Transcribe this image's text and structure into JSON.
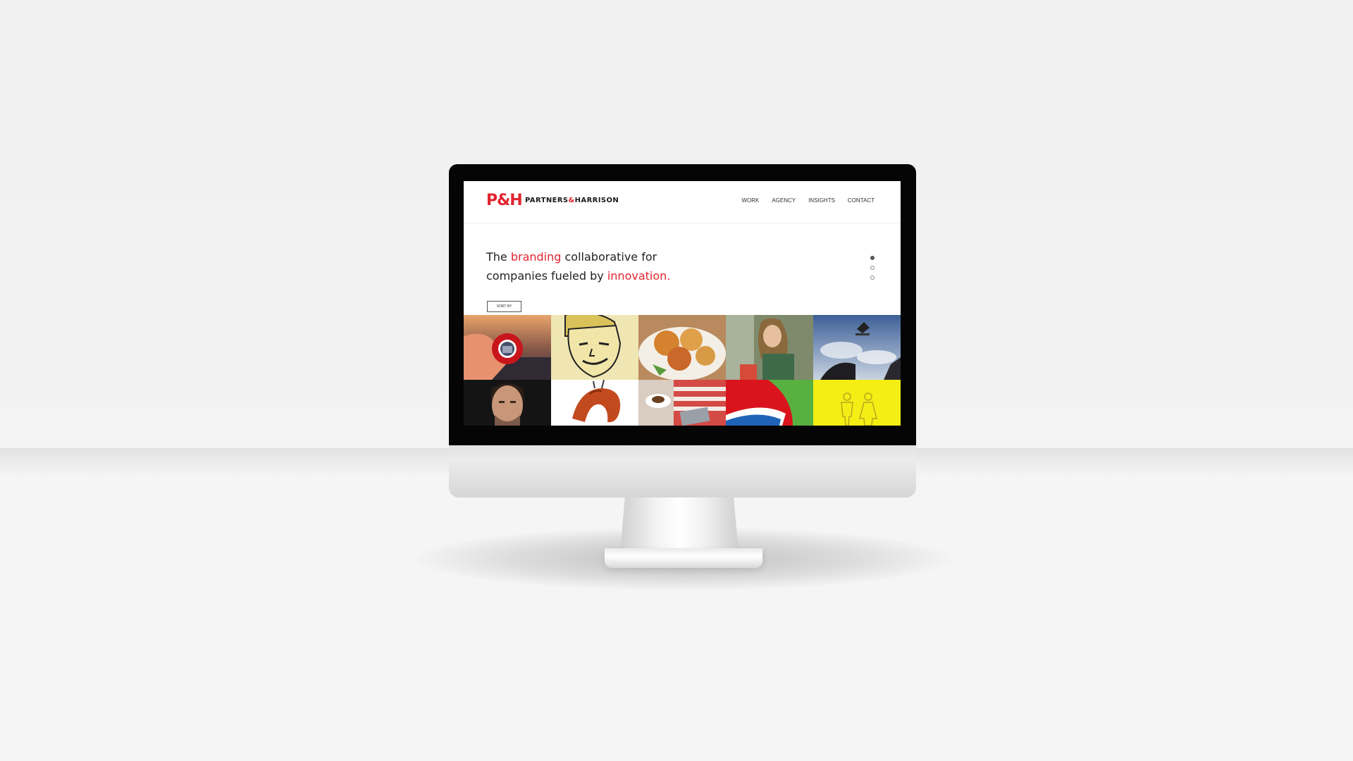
{
  "site": {
    "logo_mark": "P&H",
    "logo_text_part1": "PARTNERS",
    "logo_text_amp": "&",
    "logo_text_part2": "HARRISON",
    "nav": [
      "WORK",
      "AGENCY",
      "INSIGHTS",
      "CONTACT"
    ],
    "hero": {
      "line1_prefix": "The ",
      "line1_highlight": "branding",
      "line1_suffix": " collaborative for",
      "line2_prefix": "companies fueled by ",
      "line2_highlight": "innovation."
    },
    "sort_label": "SORT BY",
    "slider_dots": 3,
    "slider_active": 1
  },
  "colors": {
    "accent": "#e1242e",
    "text": "#222222",
    "bezel": "#050505"
  },
  "tiles": [
    {
      "id": "tile-1",
      "subject": "hand-with-red-lens-icon"
    },
    {
      "id": "tile-2",
      "subject": "retro-comic-face-icon"
    },
    {
      "id": "tile-3",
      "subject": "fried-food-plate-icon"
    },
    {
      "id": "tile-4",
      "subject": "woman-on-phone-icon"
    },
    {
      "id": "tile-5",
      "subject": "skateboard-jump-icon"
    },
    {
      "id": "tile-6",
      "subject": "man-portrait-icon"
    },
    {
      "id": "tile-7",
      "subject": "red-chili-pepper-icon"
    },
    {
      "id": "tile-8",
      "subject": "coffee-table-icon"
    },
    {
      "id": "tile-9",
      "subject": "color-swoosh-icon"
    },
    {
      "id": "tile-10",
      "subject": "restroom-figures-icon"
    }
  ]
}
